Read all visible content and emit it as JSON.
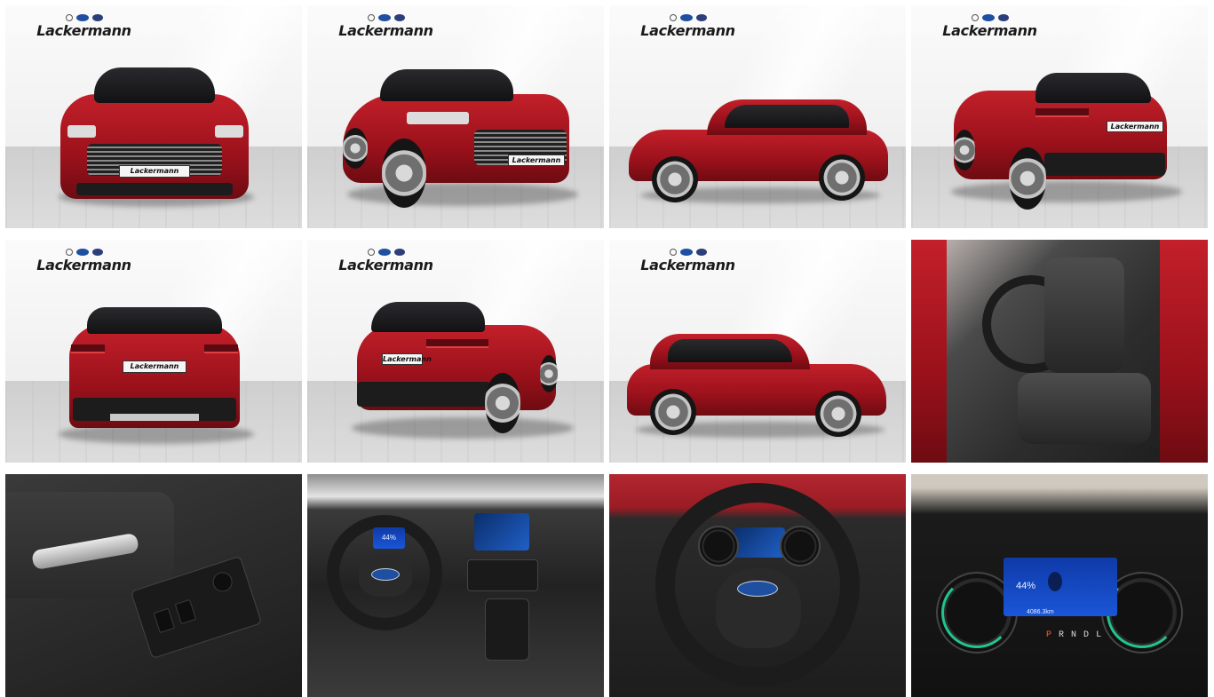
{
  "gallery": {
    "dealer_name": "Lackermann",
    "plate_text": "Lackermann",
    "brand_logos": [
      "opel-logo",
      "ford-logo",
      "hyundai-logo"
    ],
    "tiles": [
      {
        "view": "front",
        "type": "exterior"
      },
      {
        "view": "front-left-three-quarter",
        "type": "exterior"
      },
      {
        "view": "left-side",
        "type": "exterior"
      },
      {
        "view": "rear-left-three-quarter",
        "type": "exterior"
      },
      {
        "view": "rear",
        "type": "exterior"
      },
      {
        "view": "rear-right-three-quarter",
        "type": "exterior"
      },
      {
        "view": "right-side",
        "type": "exterior"
      },
      {
        "view": "front-seats",
        "type": "interior"
      },
      {
        "view": "door-panel",
        "type": "interior"
      },
      {
        "view": "dashboard",
        "type": "interior"
      },
      {
        "view": "steering-wheel",
        "type": "interior"
      },
      {
        "view": "instrument-cluster",
        "type": "interior"
      }
    ]
  },
  "cluster": {
    "battery_percent": "44%",
    "odometer": "4086.3km",
    "gears": [
      "P",
      "R",
      "N",
      "D",
      "L"
    ],
    "active_gear": "P",
    "dash_battery_percent": "44%"
  },
  "colors": {
    "car_body": "#b0202a",
    "dealer_text": "#1a1a1a",
    "ford_blue": "#1f4fa0",
    "display_blue": "#1a56d8"
  }
}
